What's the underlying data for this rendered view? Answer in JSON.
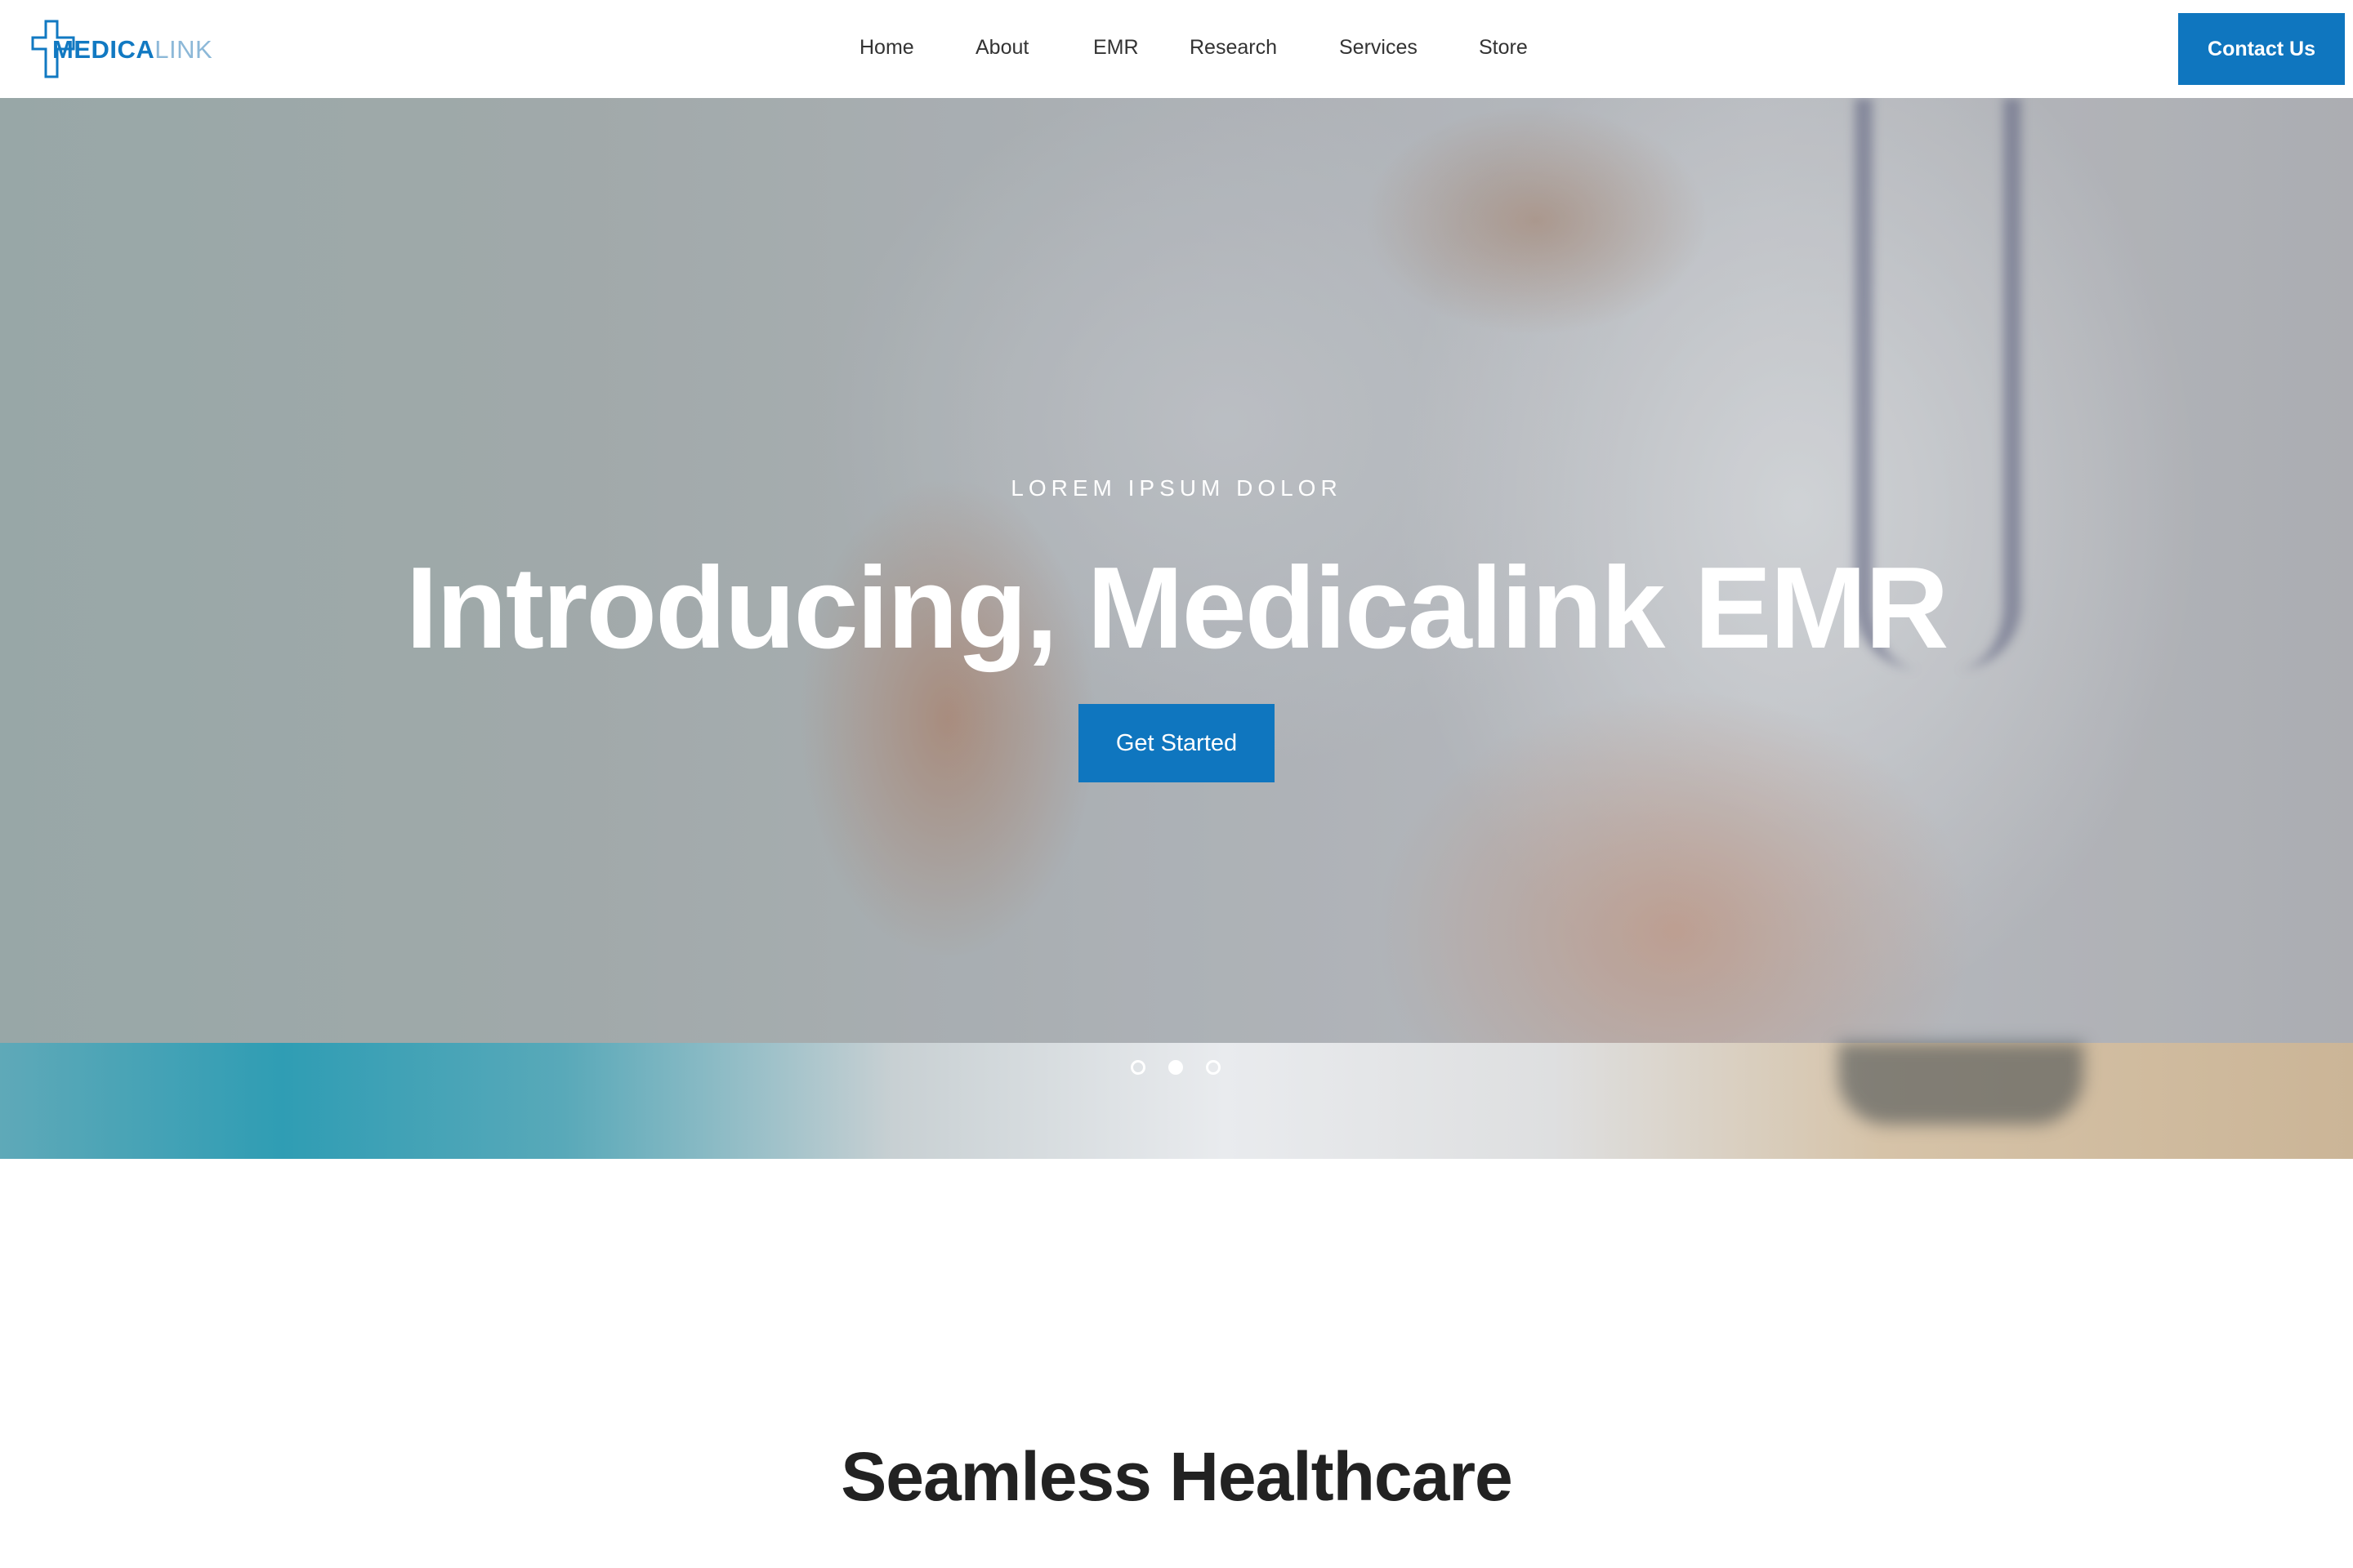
{
  "brand": {
    "name_bold": "MEDICA",
    "name_light": "LINK",
    "primary_color": "#0f76bf"
  },
  "nav": {
    "items": [
      {
        "label": "Home"
      },
      {
        "label": "About"
      },
      {
        "label": "EMR"
      },
      {
        "label": "Research"
      },
      {
        "label": "Services"
      },
      {
        "label": "Store"
      }
    ],
    "contact_label": "Contact Us"
  },
  "hero": {
    "kicker": "LOREM IPSUM DOLOR",
    "title": "Introducing, Medicalink EMR",
    "cta_label": "Get Started",
    "slide_count": 3,
    "active_slide": 2
  },
  "section": {
    "title": "Seamless Healthcare"
  }
}
